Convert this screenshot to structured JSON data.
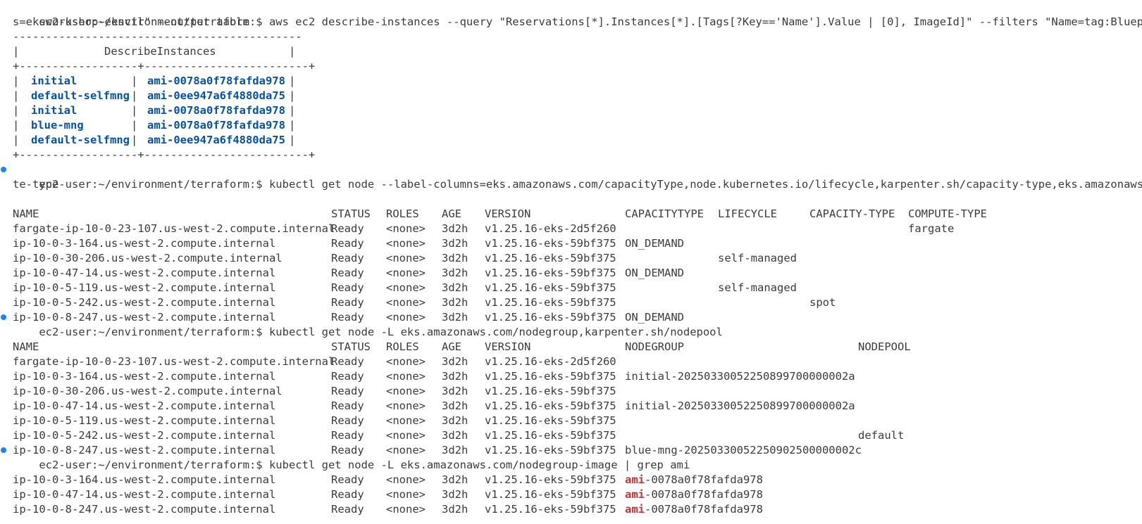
{
  "prompt": "ec2-user:~/environment/terraform:$",
  "colors": {
    "background": "#ffffff",
    "text": "#3b3b3b",
    "table_value": "#0451a5",
    "grep_match": "#cd3131",
    "status_dot": "#1a85ff"
  },
  "cmd1": {
    "command": "aws ec2 describe-instances --query \"Reservations[*].Instances[*].[Tags[?Key=='Name'].Value | [0], ImageId]\" --filters \"Name=tag:Blueprint,Value",
    "command_wrap": "s=eksworkshop-eksctl\" --output table",
    "rule": "--------------------------------------------",
    "title": "DescribeInstances",
    "sep": "+------------------+-------------------------+",
    "rows": [
      {
        "name": "initial",
        "ami": "ami-0078a0f78fafda978"
      },
      {
        "name": "default-selfmng",
        "ami": "ami-0ee947a6f4880da75"
      },
      {
        "name": "initial",
        "ami": "ami-0078a0f78fafda978"
      },
      {
        "name": "blue-mng",
        "ami": "ami-0078a0f78fafda978"
      },
      {
        "name": "default-selfmng",
        "ami": "ami-0ee947a6f4880da75"
      }
    ]
  },
  "cmd2": {
    "command": "kubectl get node --label-columns=eks.amazonaws.com/capacityType,node.kubernetes.io/lifecycle,karpenter.sh/capacity-type,eks.amazonaws.com/compu",
    "command_wrap": "te-type",
    "headers": [
      "NAME",
      "STATUS",
      "ROLES",
      "AGE",
      "VERSION",
      "CAPACITYTYPE",
      "LIFECYCLE",
      "CAPACITY-TYPE",
      "COMPUTE-TYPE"
    ],
    "rows": [
      [
        "fargate-ip-10-0-23-107.us-west-2.compute.internal",
        "Ready",
        "<none>",
        "3d2h",
        "v1.25.16-eks-2d5f260",
        "",
        "",
        "",
        "fargate"
      ],
      [
        "ip-10-0-3-164.us-west-2.compute.internal",
        "Ready",
        "<none>",
        "3d2h",
        "v1.25.16-eks-59bf375",
        "ON_DEMAND",
        "",
        "",
        ""
      ],
      [
        "ip-10-0-30-206.us-west-2.compute.internal",
        "Ready",
        "<none>",
        "3d2h",
        "v1.25.16-eks-59bf375",
        "",
        "self-managed",
        "",
        ""
      ],
      [
        "ip-10-0-47-14.us-west-2.compute.internal",
        "Ready",
        "<none>",
        "3d2h",
        "v1.25.16-eks-59bf375",
        "ON_DEMAND",
        "",
        "",
        ""
      ],
      [
        "ip-10-0-5-119.us-west-2.compute.internal",
        "Ready",
        "<none>",
        "3d2h",
        "v1.25.16-eks-59bf375",
        "",
        "self-managed",
        "",
        ""
      ],
      [
        "ip-10-0-5-242.us-west-2.compute.internal",
        "Ready",
        "<none>",
        "3d2h",
        "v1.25.16-eks-59bf375",
        "",
        "",
        "spot",
        ""
      ],
      [
        "ip-10-0-8-247.us-west-2.compute.internal",
        "Ready",
        "<none>",
        "3d2h",
        "v1.25.16-eks-59bf375",
        "ON_DEMAND",
        "",
        "",
        ""
      ]
    ]
  },
  "cmd3": {
    "command": "kubectl get node -L eks.amazonaws.com/nodegroup,karpenter.sh/nodepool",
    "headers": [
      "NAME",
      "STATUS",
      "ROLES",
      "AGE",
      "VERSION",
      "NODEGROUP",
      "NODEPOOL"
    ],
    "rows": [
      [
        "fargate-ip-10-0-23-107.us-west-2.compute.internal",
        "Ready",
        "<none>",
        "3d2h",
        "v1.25.16-eks-2d5f260",
        "",
        ""
      ],
      [
        "ip-10-0-3-164.us-west-2.compute.internal",
        "Ready",
        "<none>",
        "3d2h",
        "v1.25.16-eks-59bf375",
        "initial-20250330052250899700000002a",
        ""
      ],
      [
        "ip-10-0-30-206.us-west-2.compute.internal",
        "Ready",
        "<none>",
        "3d2h",
        "v1.25.16-eks-59bf375",
        "",
        ""
      ],
      [
        "ip-10-0-47-14.us-west-2.compute.internal",
        "Ready",
        "<none>",
        "3d2h",
        "v1.25.16-eks-59bf375",
        "initial-20250330052250899700000002a",
        ""
      ],
      [
        "ip-10-0-5-119.us-west-2.compute.internal",
        "Ready",
        "<none>",
        "3d2h",
        "v1.25.16-eks-59bf375",
        "",
        ""
      ],
      [
        "ip-10-0-5-242.us-west-2.compute.internal",
        "Ready",
        "<none>",
        "3d2h",
        "v1.25.16-eks-59bf375",
        "",
        "default"
      ],
      [
        "ip-10-0-8-247.us-west-2.compute.internal",
        "Ready",
        "<none>",
        "3d2h",
        "v1.25.16-eks-59bf375",
        "blue-mng-20250330052250902500000002c",
        ""
      ]
    ]
  },
  "cmd4": {
    "command": "kubectl get node -L eks.amazonaws.com/nodegroup-image | grep ami",
    "match": "ami",
    "rows": [
      [
        "ip-10-0-3-164.us-west-2.compute.internal",
        "Ready",
        "<none>",
        "3d2h",
        "v1.25.16-eks-59bf375",
        "-0078a0f78fafda978"
      ],
      [
        "ip-10-0-47-14.us-west-2.compute.internal",
        "Ready",
        "<none>",
        "3d2h",
        "v1.25.16-eks-59bf375",
        "-0078a0f78fafda978"
      ],
      [
        "ip-10-0-8-247.us-west-2.compute.internal",
        "Ready",
        "<none>",
        "3d2h",
        "v1.25.16-eks-59bf375",
        "-0078a0f78fafda978"
      ]
    ]
  }
}
